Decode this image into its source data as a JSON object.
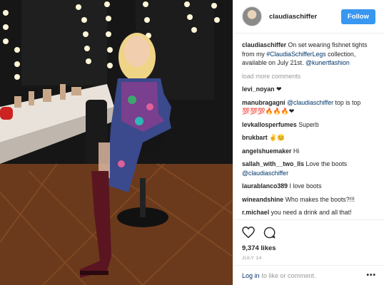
{
  "post": {
    "username": "claudiaschiffer",
    "follow_label": "Follow",
    "caption": {
      "username": "claudiaschiffer",
      "text": "On set wearing fishnet tights from my",
      "hashtag": "#ClaudiaSchifferLegs",
      "text2": "collection, available on July 21st.",
      "mention": "@kunertfashion"
    },
    "load_more": "load more comments",
    "comments": [
      {
        "user": "levi_noyan",
        "text": "❤"
      },
      {
        "user": "manubragagni",
        "mention": "@claudiaschiffer",
        "text": "top is top 💯💯💯🔥🔥🔥❤"
      },
      {
        "user": "levkallosperfumes",
        "text": "Superb"
      },
      {
        "user": "brukbart",
        "text": "✌😊"
      },
      {
        "user": "angelshuemaker",
        "text": "Hi"
      },
      {
        "user": "sallah_with__two_lls",
        "text": "Love the boots",
        "mention2": "@claudiaschiffer"
      },
      {
        "user": "laurablanco389",
        "text": "I love boots"
      },
      {
        "user": "wineandshine",
        "text": "Who makes the boots?!!!"
      },
      {
        "user": "r.michael",
        "text": "you need a drink and all that!"
      }
    ],
    "likes": "9,374 likes",
    "date": "JULY 14",
    "footer": {
      "login": "Log in",
      "rest": "to like or comment.",
      "more": "•••"
    }
  },
  "icons": {
    "like": "heart-icon",
    "comment": "comment-bubble-icon",
    "more": "more-options-icon"
  },
  "colors": {
    "follow": "#3897f0",
    "link": "#003569",
    "muted": "#999999"
  }
}
